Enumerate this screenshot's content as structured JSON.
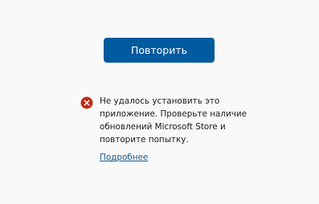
{
  "retry": {
    "label": "Повторить"
  },
  "error": {
    "icon": "error-circle-icon",
    "icon_color": "#c42b1c",
    "message": "Не удалось установить это приложение. Проверьте наличие обновлений Microsoft Store и повторите попытку.",
    "link_label": "Подробнее"
  },
  "colors": {
    "accent": "#005a9e",
    "link": "#1a5a8e",
    "background": "#f9f9f9"
  }
}
